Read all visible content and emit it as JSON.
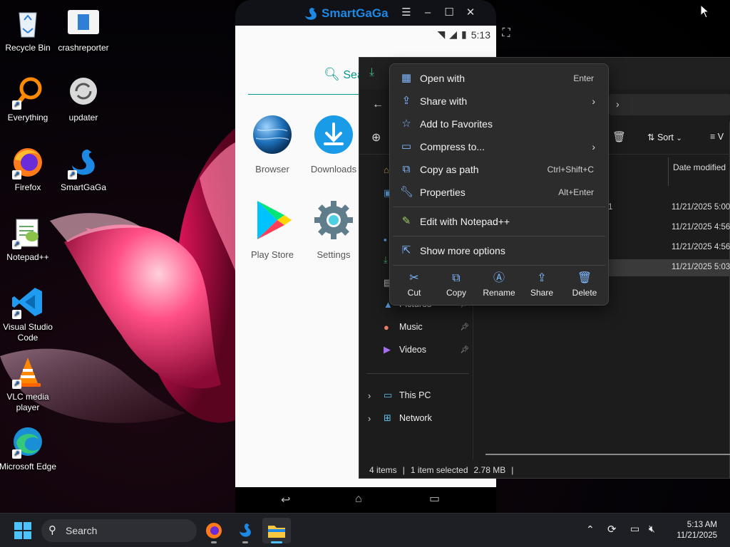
{
  "desktop": {
    "icons": [
      {
        "label": "Recycle Bin"
      },
      {
        "label": "crashreporter"
      },
      {
        "label": "Everything"
      },
      {
        "label": "updater"
      },
      {
        "label": "Firefox"
      },
      {
        "label": "SmartGaGa"
      },
      {
        "label": "Notepad++"
      },
      {
        "label": "Visual Studio Code"
      },
      {
        "label": "VLC media player"
      },
      {
        "label": "Microsoft Edge"
      }
    ]
  },
  "emulator": {
    "title": "SmartGaGa",
    "time": "5:13",
    "search_label": "Sea",
    "apps": [
      {
        "label": "Browser"
      },
      {
        "label": "Downloads"
      },
      {
        "label": "Play Store"
      },
      {
        "label": "Settings"
      }
    ]
  },
  "explorer": {
    "toolbar": {
      "sort_label": "Sort",
      "view_label": "V"
    },
    "column_date": "Date modified",
    "nav": [
      {
        "label": "Pictures"
      },
      {
        "label": "Music"
      },
      {
        "label": "Videos"
      },
      {
        "label": "This PC"
      },
      {
        "label": "Network"
      }
    ],
    "rows": [
      {
        "name_tail": "1",
        "date": "11/21/2025 5:00"
      },
      {
        "name_tail": "",
        "date": "11/21/2025 4:56"
      },
      {
        "name_tail": "",
        "date": "11/21/2025 4:56"
      },
      {
        "name_tail": "",
        "date": "11/21/2025 5:03"
      }
    ],
    "status": {
      "items": "4 items",
      "selected": "1 item selected",
      "size": "2.78 MB"
    }
  },
  "context_menu": {
    "items": [
      {
        "label": "Open with",
        "shortcut": "Enter"
      },
      {
        "label": "Share with",
        "shortcut": ""
      },
      {
        "label": "Add to Favorites",
        "shortcut": ""
      },
      {
        "label": "Compress to...",
        "shortcut": ""
      },
      {
        "label": "Copy as path",
        "shortcut": "Ctrl+Shift+C"
      },
      {
        "label": "Properties",
        "shortcut": "Alt+Enter"
      },
      {
        "label": "Edit with Notepad++",
        "shortcut": ""
      },
      {
        "label": "Show more options",
        "shortcut": ""
      }
    ],
    "quick_actions": [
      {
        "label": "Cut"
      },
      {
        "label": "Copy"
      },
      {
        "label": "Rename"
      },
      {
        "label": "Share"
      },
      {
        "label": "Delete"
      }
    ]
  },
  "taskbar": {
    "search_label": "Search",
    "time": "5:13 AM",
    "date": "11/21/2025"
  },
  "colors": {
    "accent": "#1e88e5",
    "explorer_bg": "#1c1c1c",
    "menu_bg": "#2c2c2c",
    "taskbar_bg": "#1d1f24"
  }
}
